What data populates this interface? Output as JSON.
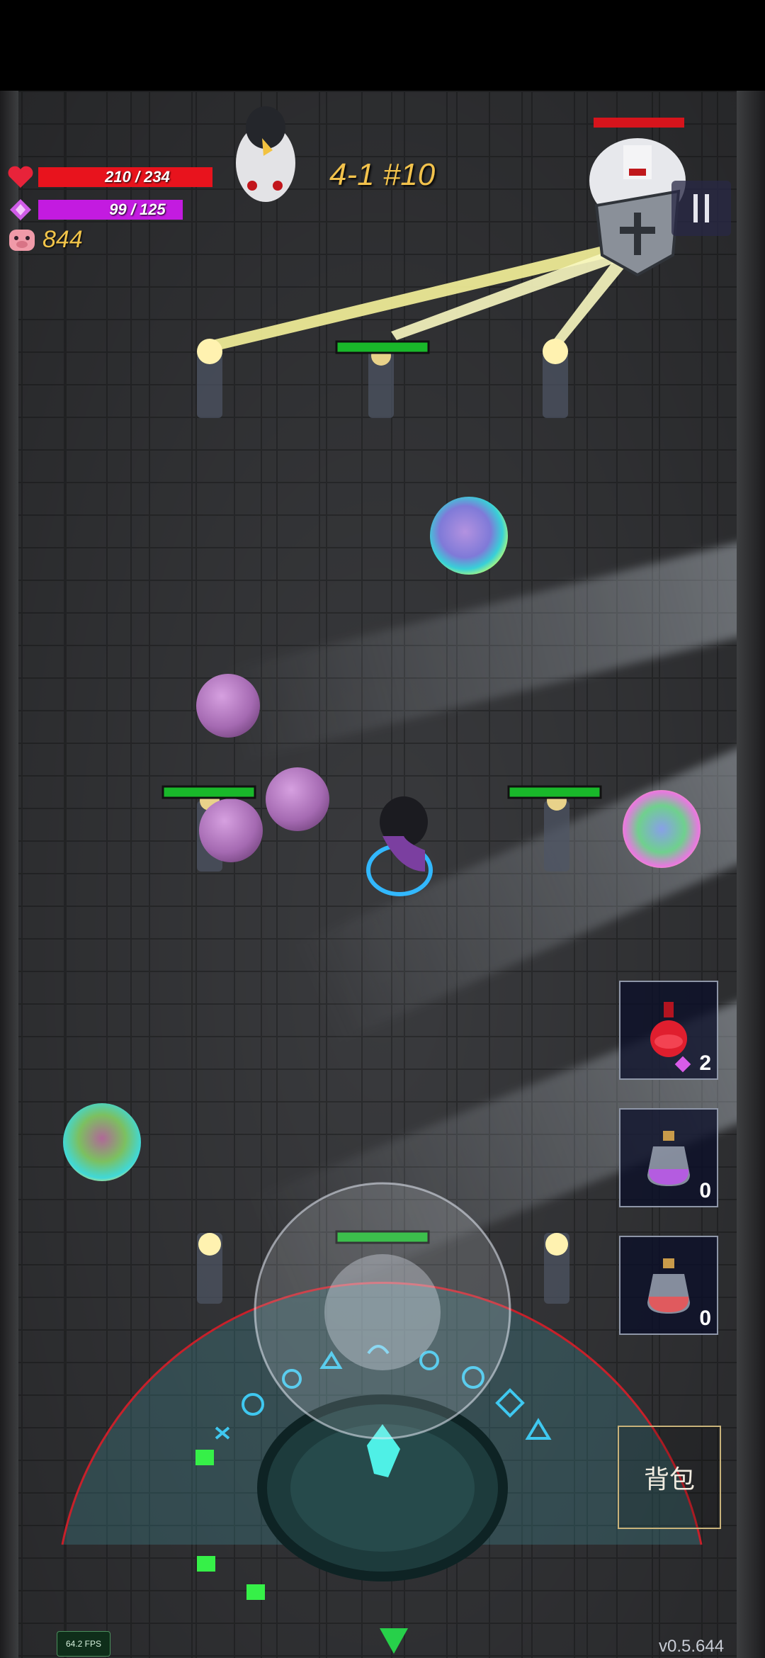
{
  "hud": {
    "hp_text": "210 / 234",
    "hp": 210,
    "hp_max": 234,
    "mp_text": "99 / 125",
    "mp": 99,
    "mp_max": 125,
    "coins": "844",
    "stage_label": "4-1 #10"
  },
  "potions": [
    {
      "name": "red-health-potion",
      "count": "2",
      "shows_cost_gem": true
    },
    {
      "name": "purple-mana-potion",
      "count": "0",
      "shows_cost_gem": false
    },
    {
      "name": "red-small-potion",
      "count": "0",
      "shows_cost_gem": false
    }
  ],
  "buttons": {
    "bag_label": "背包"
  },
  "footer": {
    "fps": "64.2 FPS",
    "version": "v0.5.644"
  },
  "colors": {
    "hp_fill": "#e8131d",
    "mp_fill": "#c31be0",
    "coin_text": "#f1c44a",
    "stage_text": "#f2c24c",
    "enemy_hp": "#19b82a",
    "boss_hp": "#d6141c"
  },
  "icons": {
    "hp": "heart-icon",
    "mp": "diamond-gem-icon",
    "coins": "pig-coin-icon",
    "pause": "pause-icon",
    "exit_arrow": "triangle-down-icon"
  }
}
